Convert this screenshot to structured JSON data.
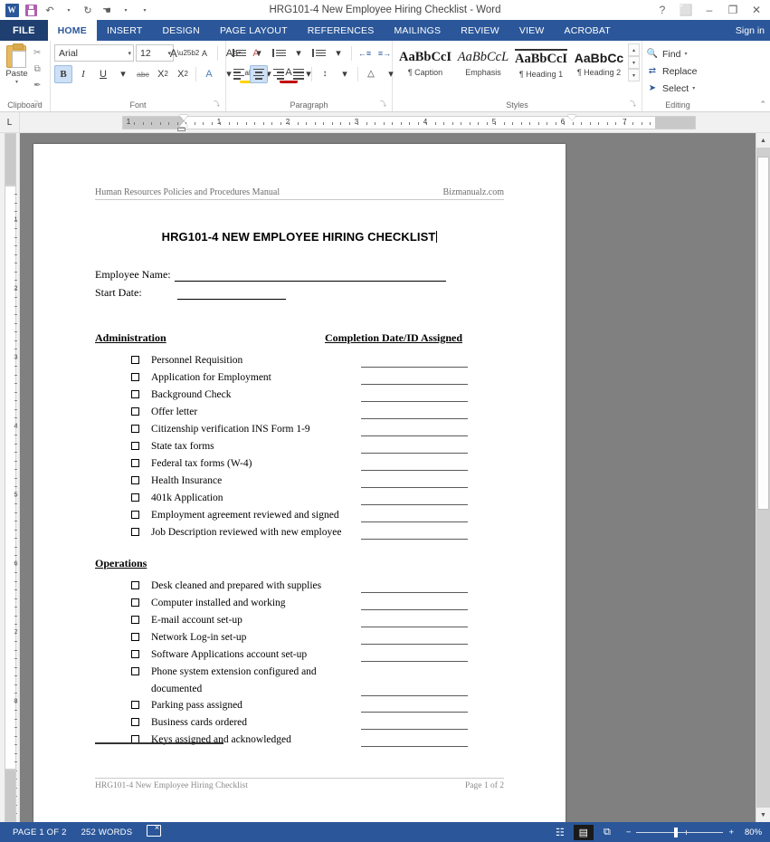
{
  "titlebar": {
    "document_title": "HRG101-4 New Employee Hiring Checklist - Word",
    "quick_access": [
      {
        "name": "word-app-icon",
        "glyph": "W"
      },
      {
        "name": "save-icon",
        "glyph": ""
      },
      {
        "name": "undo-icon",
        "glyph": "↶"
      },
      {
        "name": "redo-icon",
        "glyph": "↻"
      },
      {
        "name": "touch-mouse-mode-icon",
        "glyph": "☚"
      }
    ],
    "customize_arrow": "▾",
    "window_controls": [
      {
        "name": "help-button",
        "glyph": "?"
      },
      {
        "name": "ribbon-display-options-button",
        "glyph": "⬜"
      },
      {
        "name": "minimize-button",
        "glyph": "–"
      },
      {
        "name": "maximize-button",
        "glyph": "❐"
      },
      {
        "name": "close-button",
        "glyph": "✕"
      }
    ],
    "sign_in": "Sign in"
  },
  "ribbon_tabs": {
    "file": "FILE",
    "items": [
      "HOME",
      "INSERT",
      "DESIGN",
      "PAGE LAYOUT",
      "REFERENCES",
      "MAILINGS",
      "REVIEW",
      "VIEW",
      "ACROBAT"
    ],
    "active": "HOME"
  },
  "ribbon": {
    "clipboard": {
      "label": "Clipboard",
      "paste_label": "Paste",
      "paste_arrow": "▾",
      "cut_icon": "✂",
      "copy_icon": "⧉",
      "format_painter_icon": "✒",
      "dialog_launcher": "⤵"
    },
    "font": {
      "label": "Font",
      "font_name": "Arial",
      "font_size": "12",
      "dropdown_arrow": "▾",
      "grow_font": "A",
      "shrink_font": "A",
      "change_case": "Aa",
      "clear_formatting": "A",
      "bold": "B",
      "italic": "I",
      "underline": "U",
      "strikethrough": "abc",
      "subscript": "X",
      "subscript_mark": "2",
      "superscript": "X",
      "superscript_mark": "2",
      "text_effects": "A",
      "highlight": "ab",
      "font_color": "A",
      "dialog_launcher": "⤵"
    },
    "paragraph": {
      "label": "Paragraph",
      "bullets": "bullets-icon",
      "numbering": "numbering-icon",
      "multilevel": "multilevel-list-icon",
      "decrease_indent": "←≡",
      "increase_indent": "≡→",
      "sort": "A↓",
      "show_marks": "¶",
      "align_left": "align-left-icon",
      "align_center": "align-center-icon",
      "align_right": "align-right-icon",
      "justify": "justify-icon",
      "line_spacing": "↕",
      "shading": "△",
      "borders": "⊞",
      "dialog_launcher": "⤵"
    },
    "styles": {
      "label": "Styles",
      "items": [
        {
          "preview": "AaBbCcI",
          "name": "¶ Caption"
        },
        {
          "preview": "AaBbCcL",
          "name": "Emphasis"
        },
        {
          "preview": "AaBbCcI",
          "name": "¶ Heading 1"
        },
        {
          "preview": "AaBbCc",
          "name": "¶ Heading 2"
        }
      ],
      "scroll_up": "▴",
      "scroll_down": "▾",
      "more": "▾",
      "dialog_launcher": "⤵"
    },
    "editing": {
      "label": "Editing",
      "items": [
        {
          "icon": "🔍",
          "label": "Find",
          "arrow": "▾"
        },
        {
          "icon": "⇄",
          "label": "Replace",
          "arrow": ""
        },
        {
          "icon": "➤",
          "label": "Select",
          "arrow": "▾"
        }
      ]
    },
    "collapse_ribbon": "⌃"
  },
  "ruler": {
    "tab_selector": "L",
    "horizontal_numbers": [
      "1",
      "1",
      "2",
      "3",
      "4",
      "5",
      "6",
      "7"
    ],
    "vertical_numbers": [
      "1",
      "2",
      "3",
      "4",
      "5",
      "6",
      "7",
      "8"
    ]
  },
  "document": {
    "header_left": "Human Resources Policies and Procedures Manual",
    "header_right": "Bizmanualz.com",
    "title": "HRG101-4 NEW EMPLOYEE HIRING CHECKLIST",
    "fields": [
      {
        "label": "Employee Name:",
        "value": "",
        "line_width": 300
      },
      {
        "label": "Start Date:",
        "value": "",
        "line_width": 120
      }
    ],
    "column_header": "Completion Date/ID Assigned",
    "sections": [
      {
        "heading": "Administration",
        "items": [
          {
            "label": "Personnel Requisition",
            "checked": false,
            "line": true
          },
          {
            "label": "Application for Employment",
            "checked": false,
            "line": true
          },
          {
            "label": "Background Check",
            "checked": false,
            "line": true
          },
          {
            "label": "Offer letter",
            "checked": false,
            "line": true
          },
          {
            "label": "Citizenship verification INS Form 1-9",
            "checked": false,
            "line": true
          },
          {
            "label": "State tax forms",
            "checked": false,
            "line": true
          },
          {
            "label": "Federal tax forms (W-4)",
            "checked": false,
            "line": true
          },
          {
            "label": "Health Insurance",
            "checked": false,
            "line": true
          },
          {
            "label": "401k Application",
            "checked": false,
            "line": true
          },
          {
            "label": "Employment agreement reviewed and signed",
            "checked": false,
            "line": true
          },
          {
            "label": "Job Description reviewed with new employee",
            "checked": false,
            "line": true
          }
        ]
      },
      {
        "heading": "Operations",
        "items": [
          {
            "label": "Desk cleaned and prepared with supplies",
            "checked": false,
            "line": true
          },
          {
            "label": "Computer installed and working",
            "checked": false,
            "line": true
          },
          {
            "label": "E-mail account set-up",
            "checked": false,
            "line": true
          },
          {
            "label": "Network Log-in set-up",
            "checked": false,
            "line": true
          },
          {
            "label": "Software Applications account set-up",
            "checked": false,
            "line": true
          },
          {
            "label": "Phone system extension configured and documented",
            "checked": false,
            "line": true
          },
          {
            "label": "Parking pass assigned",
            "checked": false,
            "line": true
          },
          {
            "label": "Business cards ordered",
            "checked": false,
            "line": true
          },
          {
            "label": "Keys assigned and acknowledged",
            "checked": false,
            "line": true
          }
        ]
      }
    ],
    "footer_left": "HRG101-4 New Employee Hiring Checklist",
    "footer_right": "Page 1 of 2"
  },
  "statusbar": {
    "page_info": "PAGE 1 OF 2",
    "word_count": "252 WORDS",
    "proofing_icon": "proofing-errors-icon",
    "view_buttons": [
      {
        "name": "read-mode-button",
        "glyph": "☷",
        "selected": false
      },
      {
        "name": "print-layout-button",
        "glyph": "▤",
        "selected": true
      },
      {
        "name": "web-layout-button",
        "glyph": "⧉",
        "selected": false
      }
    ],
    "zoom_out": "−",
    "zoom_in": "+",
    "zoom_level": "80%"
  },
  "scrollbar": {
    "up_arrow": "▲",
    "down_arrow": "▼"
  },
  "colors": {
    "accent": "#2b579a",
    "file_tab": "#1e3f70",
    "workspace": "#808080"
  }
}
